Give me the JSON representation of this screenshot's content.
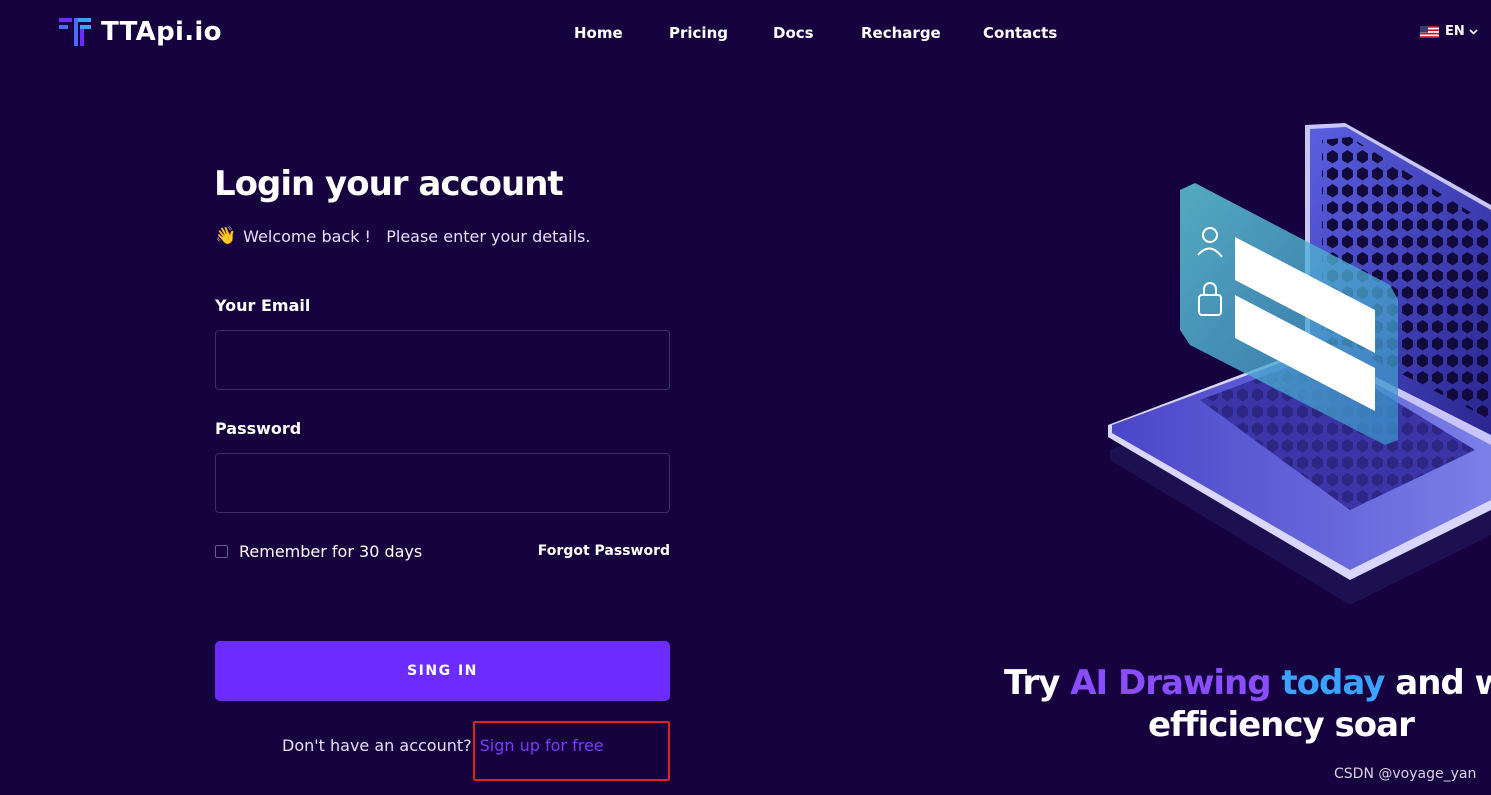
{
  "header": {
    "logo_text": "TTApi.io",
    "nav": [
      "Home",
      "Pricing",
      "Docs",
      "Recharge",
      "Contacts"
    ],
    "language": "EN"
  },
  "login": {
    "title": "Login your account",
    "wave_emoji": "👋",
    "welcome": "Welcome back !   Please enter your details.",
    "email_label": "Your Email",
    "email_value": "",
    "password_label": "Password",
    "password_value": "",
    "remember_label": "Remember for 30 days",
    "forgot_label": "Forgot Password",
    "signin_label": "SING IN",
    "no_account_text": "Don't have an account?",
    "signup_label": "Sign up for free"
  },
  "promo": {
    "part1": "Try ",
    "part2": "AI Drawing ",
    "part3": "today",
    "part4": " and watc",
    "line2": "efficiency soar"
  },
  "watermark": "CSDN @voyage_yan",
  "colors": {
    "background": "#16023e",
    "accent": "#6c2bff",
    "link": "#7a3cff",
    "highlight_blue": "#3aa2ff",
    "annotation_red": "#e02020"
  },
  "icons": [
    "logo-icon",
    "us-flag-icon",
    "chevron-down-icon",
    "waving-hand-icon",
    "login-laptop-illustration"
  ]
}
